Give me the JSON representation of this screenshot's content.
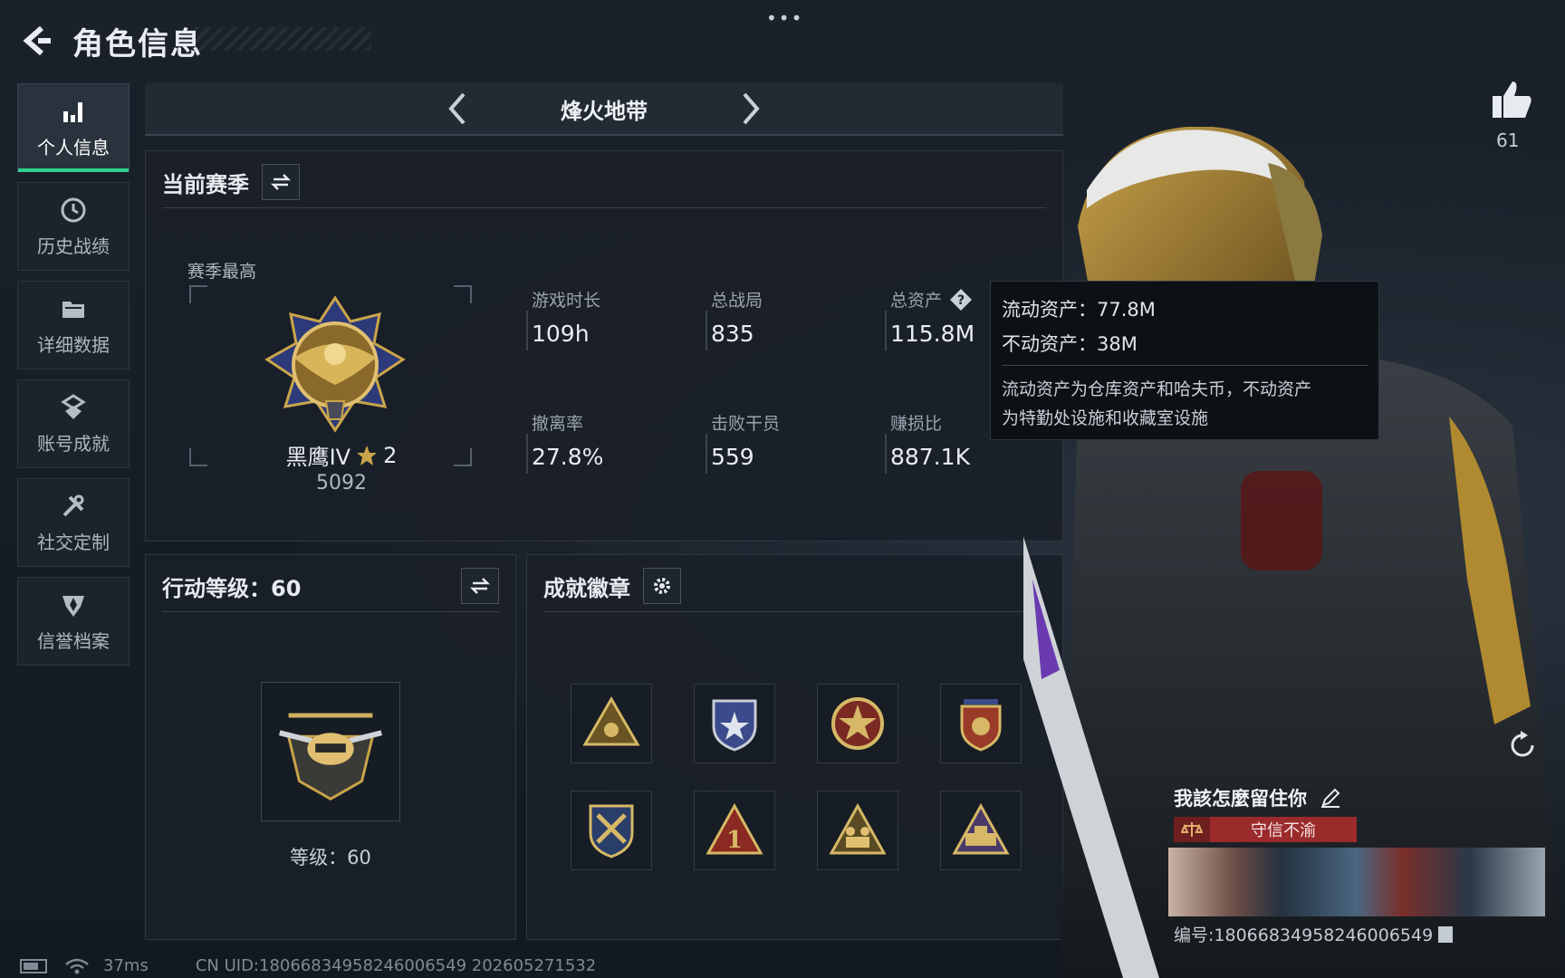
{
  "header": {
    "title": "角色信息",
    "menu_dots": "•••"
  },
  "sidebar": {
    "items": [
      {
        "label": "个人信息",
        "icon": "bar-chart-icon",
        "active": true
      },
      {
        "label": "历史战绩",
        "icon": "history-icon",
        "active": false
      },
      {
        "label": "详细数据",
        "icon": "folder-icon",
        "active": false
      },
      {
        "label": "账号成就",
        "icon": "achievement-icon",
        "active": false
      },
      {
        "label": "社交定制",
        "icon": "tools-icon",
        "active": false
      },
      {
        "label": "信誉档案",
        "icon": "shield-icon",
        "active": false
      }
    ]
  },
  "mode": {
    "title": "烽火地带"
  },
  "season": {
    "title": "当前赛季",
    "best_label": "赛季最高",
    "rank_name": "黑鹰IV",
    "rank_stars": "2",
    "rank_score": "5092",
    "stats": [
      {
        "label": "游戏时长",
        "value": "109h"
      },
      {
        "label": "总战局",
        "value": "835"
      },
      {
        "label": "总资产",
        "value": "115.8M"
      },
      {
        "label": "撤离率",
        "value": "27.8%"
      },
      {
        "label": "击败干员",
        "value": "559"
      },
      {
        "label": "赚损比",
        "value": "887.1K"
      }
    ]
  },
  "tooltip": {
    "liquid": "流动资产：77.8M",
    "fixed": "不动资产：38M",
    "desc_line1": "流动资产为仓库资产和哈夫币，不动资产",
    "desc_line2": "为特勤处设施和收藏室设施"
  },
  "action_level": {
    "title": "行动等级：60",
    "level_label": "等级：60"
  },
  "badges": {
    "title": "成就徽章",
    "items": [
      "triangle-badge-icon",
      "shield-star-badge-icon",
      "star-medal-badge-icon",
      "crest-badge-icon",
      "crossed-arms-badge-icon",
      "number-one-badge-icon",
      "soldiers-badge-icon",
      "gold-tank-badge-icon"
    ]
  },
  "profile": {
    "likes": "61",
    "nickname": "我該怎麼留住你",
    "title_tag": "守信不渝",
    "card_uid": "编号:18066834958246006549"
  },
  "status": {
    "ping": "37ms",
    "uid_line": "CN UID:18066834958246006549 202605271532"
  },
  "colors": {
    "accent_green": "#2fd08a",
    "tag_red": "#9b2a2a",
    "gold": "#c9a44a"
  }
}
